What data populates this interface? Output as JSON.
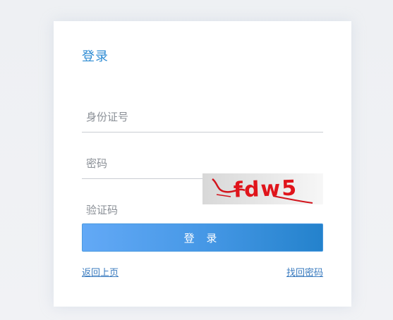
{
  "form": {
    "title": "登录",
    "id_placeholder": "身份证号",
    "password_placeholder": "密码",
    "captcha_placeholder": "验证码",
    "captcha_text": "fdw5",
    "login_label": "登 录",
    "back_link": "返回上页",
    "forgot_link": "找回密码"
  },
  "colors": {
    "accent": "#2d8bd3",
    "captcha_text": "#e0141b"
  }
}
